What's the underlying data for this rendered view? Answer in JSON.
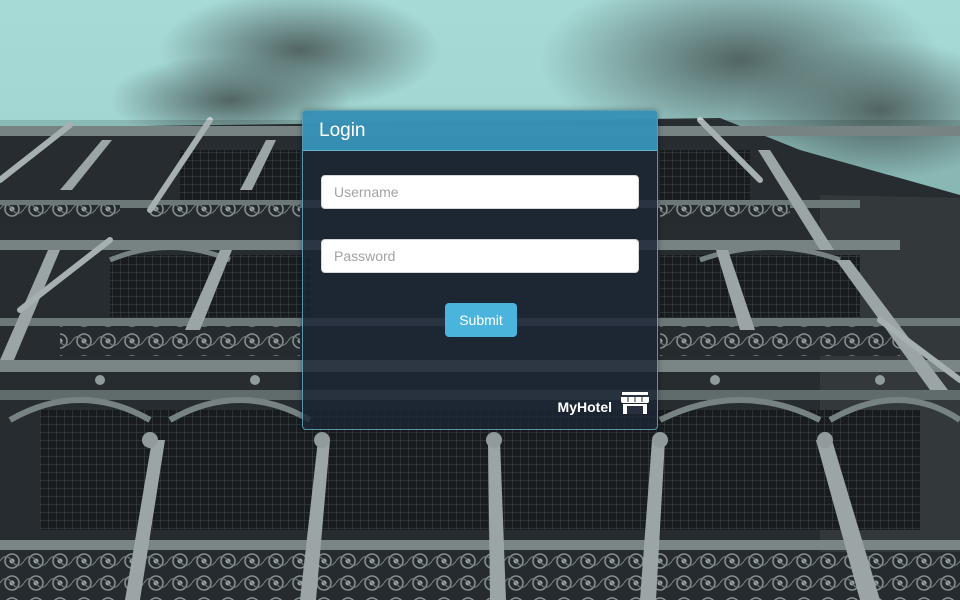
{
  "login": {
    "title": "Login",
    "username_placeholder": "Username",
    "password_placeholder": "Password",
    "submit_label": "Submit"
  },
  "brand": {
    "name": "MyHotel",
    "icon": "storefront-icon"
  },
  "colors": {
    "header_blue": "#3a9ec4",
    "button_blue": "#4bb4dd",
    "sky_teal": "#9ed3d0",
    "panel_dark": "#1c2434"
  }
}
